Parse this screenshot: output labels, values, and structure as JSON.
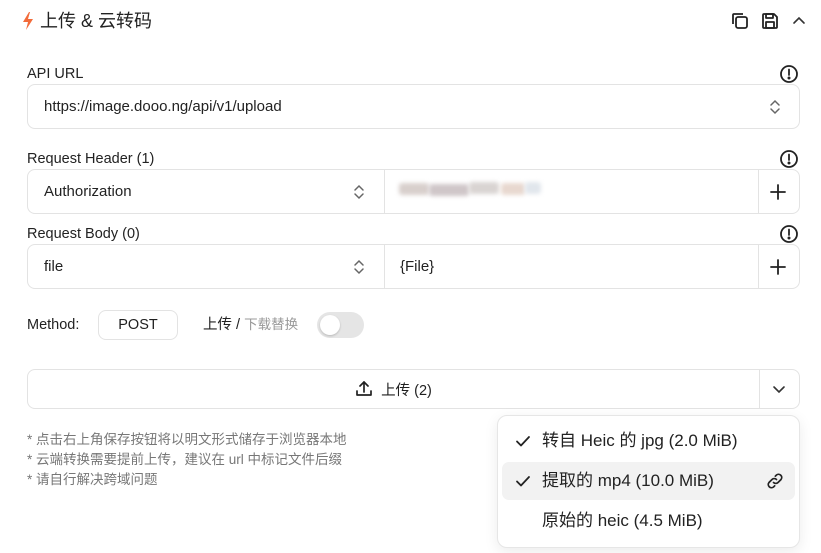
{
  "header": {
    "title": "上传 & 云转码",
    "icons": [
      "bolt-icon",
      "copy-icon",
      "save-icon",
      "chevron-up-icon"
    ],
    "accent_color": "#f26b3a"
  },
  "api_url": {
    "label": "API URL",
    "value": "https://image.dooo.ng/api/v1/upload"
  },
  "request_header": {
    "label": "Request Header (1)",
    "key": "Authorization",
    "value_redacted": true
  },
  "request_body": {
    "label": "Request Body (0)",
    "key": "file",
    "value": "{File}"
  },
  "method": {
    "label": "Method:",
    "value": "POST"
  },
  "upload_toggle": {
    "on_label": "上传",
    "separator": "/",
    "off_label": "下载替换",
    "enabled": false
  },
  "upload_button": {
    "label": "上传 (2)"
  },
  "notes": [
    "* 点击右上角保存按钮将以明文形式储存于浏览器本地",
    "* 云端转换需要提前上传，建议在 url 中标记文件后缀",
    "* 请自行解决跨域问题"
  ],
  "dropdown": {
    "items": [
      {
        "label": "转自 Heic 的 jpg (2.0 MiB)",
        "checked": true,
        "active": false
      },
      {
        "label": "提取的 mp4 (10.0 MiB)",
        "checked": true,
        "active": true
      },
      {
        "label": "原始的 heic (4.5 MiB)",
        "checked": false,
        "active": false
      }
    ]
  }
}
